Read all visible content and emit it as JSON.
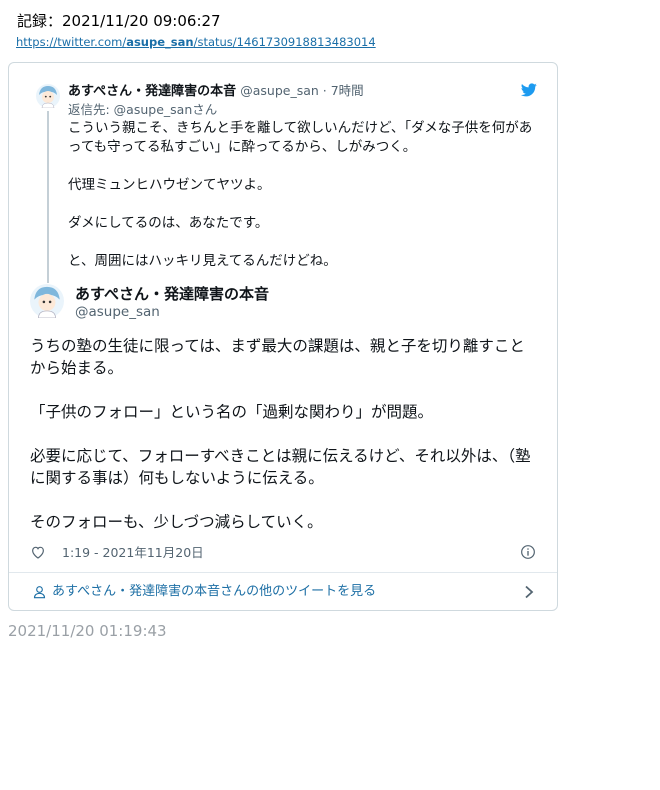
{
  "record": {
    "label": "記録：2021/11/20 09:06:27"
  },
  "source_url": {
    "prefix": "https://twitter.com/",
    "user": "asupe_san",
    "suffix": "/status/1461730918813483014"
  },
  "parent_tweet": {
    "name": "あすぺさん・発達障害の本音",
    "meta": "@asupe_san · 7時間",
    "reply_to": "返信先: @asupe_sanさん",
    "paragraphs": [
      "こういう親こそ、きちんと手を離して欲しいんだけど、「ダメな子供を何があっても守ってる私すごい」に酔ってるから、しがみつく。",
      "代理ミュンヒハウゼンてヤツよ。",
      "ダメにしてるのは、あなたです。",
      "と、周囲にはハッキリ見えてるんだけどね。"
    ]
  },
  "main_tweet": {
    "name": "あすぺさん・発達障害の本音",
    "handle": "@asupe_san",
    "paragraphs": [
      "うちの塾の生徒に限っては、まず最大の課題は、親と子を切り離すことから始まる。",
      "「子供のフォロー」という名の「過剰な関わり」が問題。",
      "必要に応じて、フォローすべきことは親に伝えるけど、それ以外は、（塾に関する事は）何もしないように伝える。",
      "そのフォローも、少しづつ減らしていく。"
    ],
    "timestamp": "1:19 - 2021年11月20日"
  },
  "more_tweets": {
    "label": "あすぺさん・発達障害の本音さんの他のツイートを見る"
  },
  "footer": {
    "timestamp": "2021/11/20 01:19:43"
  },
  "icons": {
    "twitter": "twitter-bird-icon",
    "like": "heart-icon",
    "info": "info-icon",
    "user": "user-icon",
    "chevron": "chevron-right-icon"
  },
  "colors": {
    "link": "#1b6fa8",
    "twitter_blue": "#1d9bf0",
    "muted": "#536471"
  }
}
